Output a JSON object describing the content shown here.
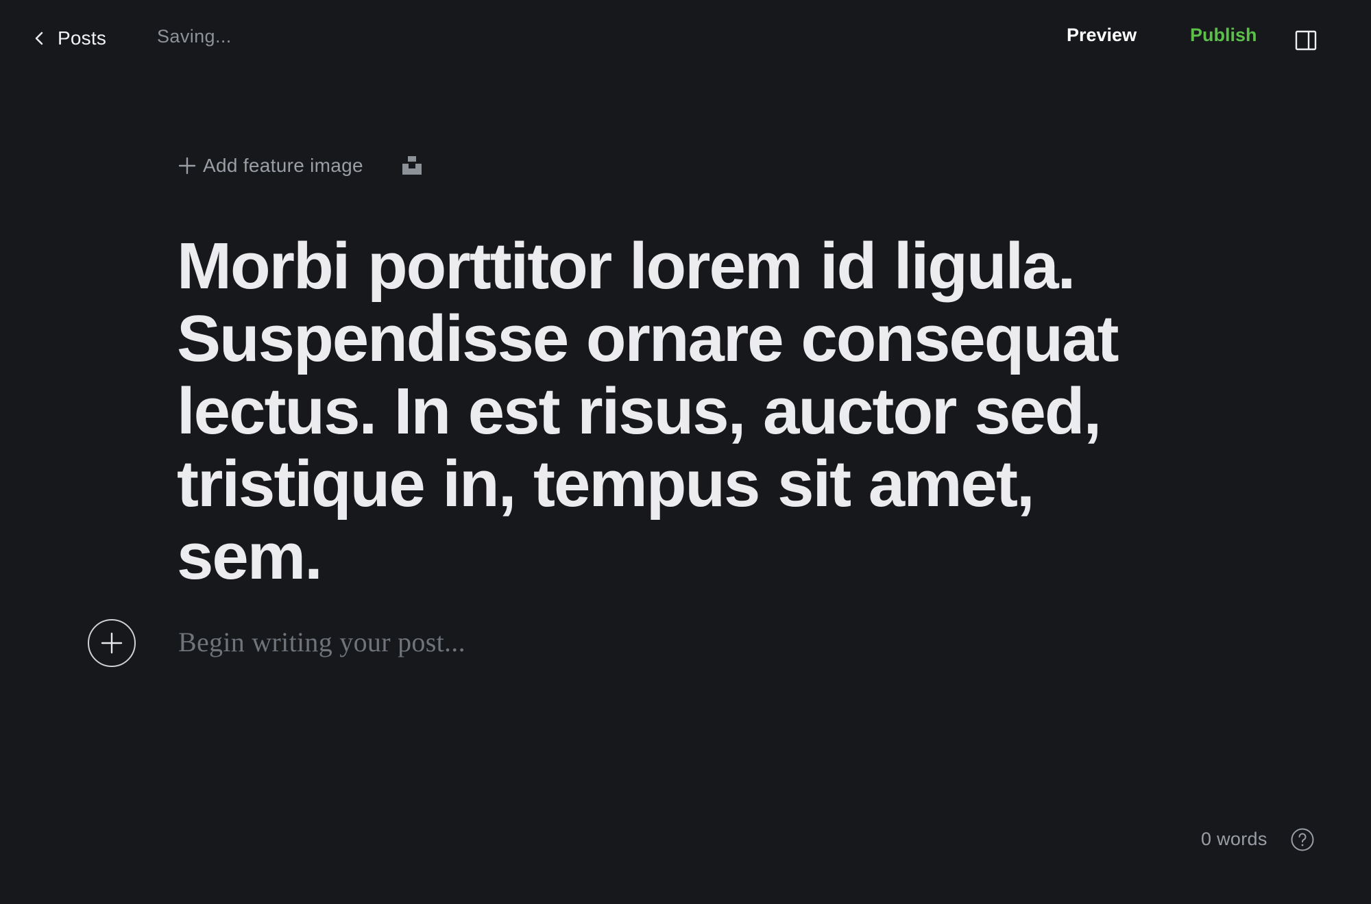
{
  "topbar": {
    "back_label": "Posts",
    "status": "Saving...",
    "preview_label": "Preview",
    "publish_label": "Publish",
    "publish_color": "#5cbf4a",
    "sidebar_toggle_icon": "sidebar-toggle-icon"
  },
  "editor": {
    "add_feature_image_label": "Add feature image",
    "unsplash_icon": "unsplash-icon",
    "title": "Morbi porttitor lorem id ligula. Suspendisse ornare consequat lectus. In est risus, auctor sed, tristique in, tempus sit amet, sem.",
    "body_placeholder": "Begin writing your post..."
  },
  "footer": {
    "word_count": "0 words",
    "help_icon": "help-icon"
  },
  "colors": {
    "background": "#17181c",
    "title_text": "#ececee",
    "muted_text": "#9a9ea5",
    "accent_green": "#5cbf4a"
  }
}
